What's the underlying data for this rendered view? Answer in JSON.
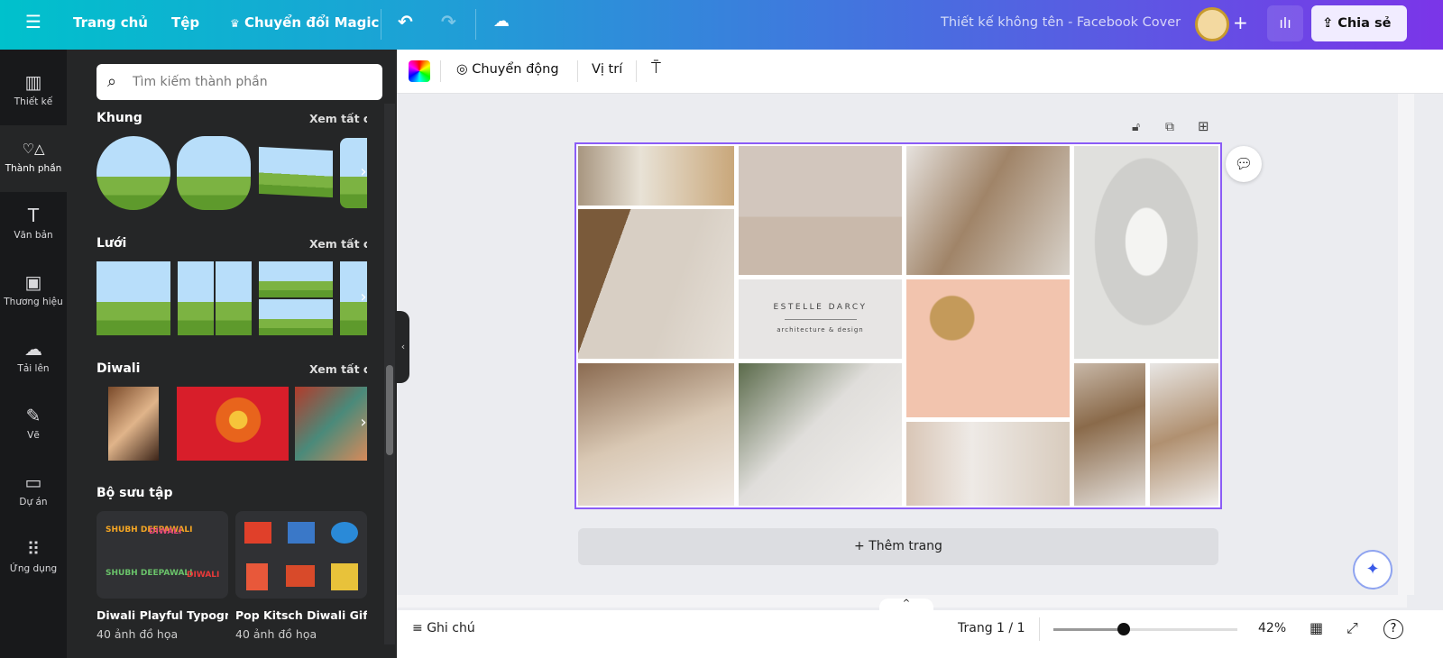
{
  "topbar": {
    "home": "Trang chủ",
    "file": "Tệp",
    "magic": "Chuyển đổi Magic",
    "doc_title": "Thiết kế không tên - Facebook Cover",
    "share": "Chia sẻ",
    "crown": "♛"
  },
  "rail": [
    {
      "label": "Thiết kế",
      "icon": "▥"
    },
    {
      "label": "Thành phần",
      "icon": "♡△"
    },
    {
      "label": "Văn bản",
      "icon": "T"
    },
    {
      "label": "Thương hiệu",
      "icon": "▣"
    },
    {
      "label": "Tải lên",
      "icon": "☁"
    },
    {
      "label": "Vẽ",
      "icon": "✎"
    },
    {
      "label": "Dự án",
      "icon": "▭"
    },
    {
      "label": "Ứng dụng",
      "icon": "⠿"
    }
  ],
  "panel": {
    "search_placeholder": "Tìm kiếm thành phần",
    "see_all": "Xem tất cả",
    "sections": {
      "frames": "Khung",
      "grids": "Lưới",
      "diwali": "Diwali",
      "collections": "Bộ sưu tập"
    },
    "collections": [
      {
        "title": "Diwali Playful Typogra...",
        "count": "40 ảnh đồ họa"
      },
      {
        "title": "Pop Kitsch Diwali Gifti...",
        "count": "40 ảnh đồ họa"
      }
    ],
    "sticker_texts": [
      "SHUBH DEEPAWALI",
      "DIWALI",
      "DIWALI"
    ]
  },
  "toolbar": {
    "animate": "Chuyển động",
    "position": "Vị trí"
  },
  "design": {
    "brand_name": "ESTELLE DARCY",
    "brand_tagline": "architecture & design"
  },
  "add_page": "+ Thêm trang",
  "bottom": {
    "notes": "Ghi chú",
    "page": "Trang 1 / 1",
    "zoom": "42%",
    "zoom_value": 42
  }
}
